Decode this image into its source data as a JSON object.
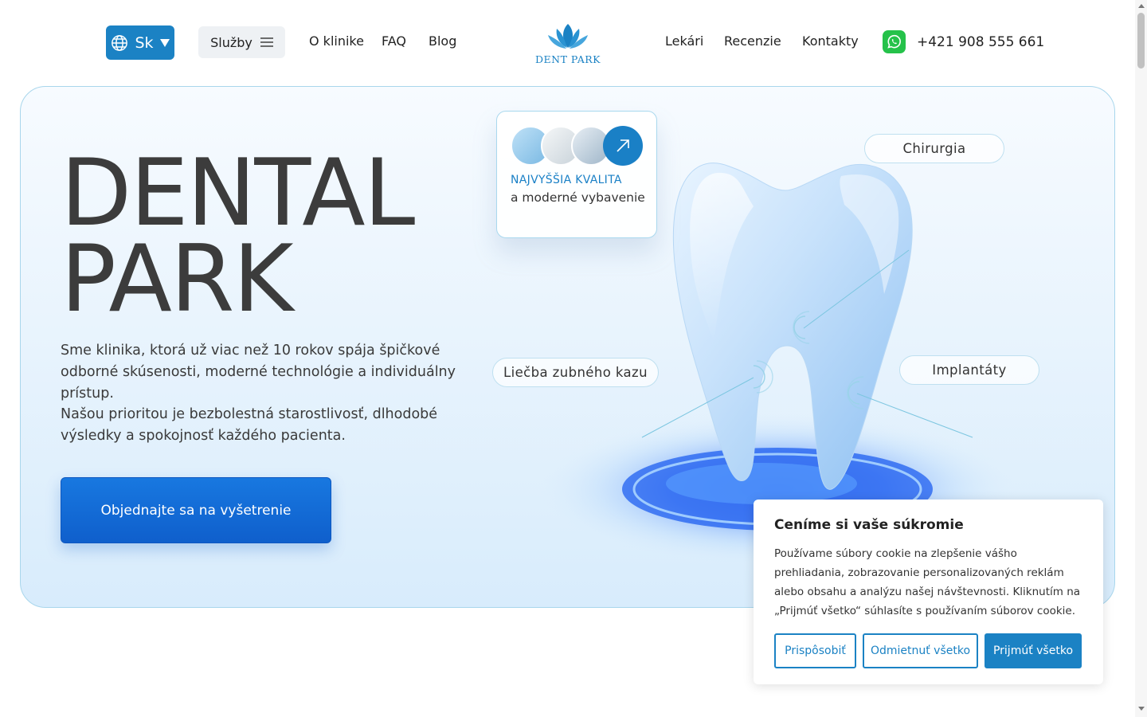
{
  "header": {
    "language": "Sk",
    "services_label": "Služby",
    "nav_left": [
      "O klinike",
      "FAQ",
      "Blog"
    ],
    "logo_text": "DENT PARK",
    "nav_right": [
      "Lekári",
      "Recenzie",
      "Kontakty"
    ],
    "phone": "+421 908 555 661"
  },
  "hero": {
    "title_line1": "DENTAL",
    "title_line2": "PARK",
    "description_p1": "Sme klinika, ktorá už viac než 10 rokov spája špičkové odborné skúsenosti, moderné technológie a individuálny prístup.",
    "description_p2": "Našou prioritou je bezbolestná starostlivosť, dlhodobé výsledky a spokojnosť každého pacienta.",
    "cta": "Objednajte sa na vyšetrenie",
    "quality_title": "NAJVYŠŠIA KVALITA",
    "quality_subtitle": "a moderné vybavenie",
    "labels": {
      "surgery": "Chirurgia",
      "caries": "Liečba zubného kazu",
      "implants": "Implantáty"
    }
  },
  "cookie": {
    "title": "Ceníme si vaše súkromie",
    "text": "Používame súbory cookie na zlepšenie vášho prehliadania, zobrazovanie personalizovaných reklám alebo obsahu a analýzu našej návštevnosti. Kliknutím na „Prijmúť všetko“ súhlasíte s používaním súborov cookie.",
    "customize": "Prispôsobiť",
    "reject": "Odmietnuť všetko",
    "accept": "Prijmúť všetko"
  },
  "colors": {
    "brand": "#1b82c4",
    "cta": "#0f5fcc",
    "whatsapp": "#25c24a"
  }
}
